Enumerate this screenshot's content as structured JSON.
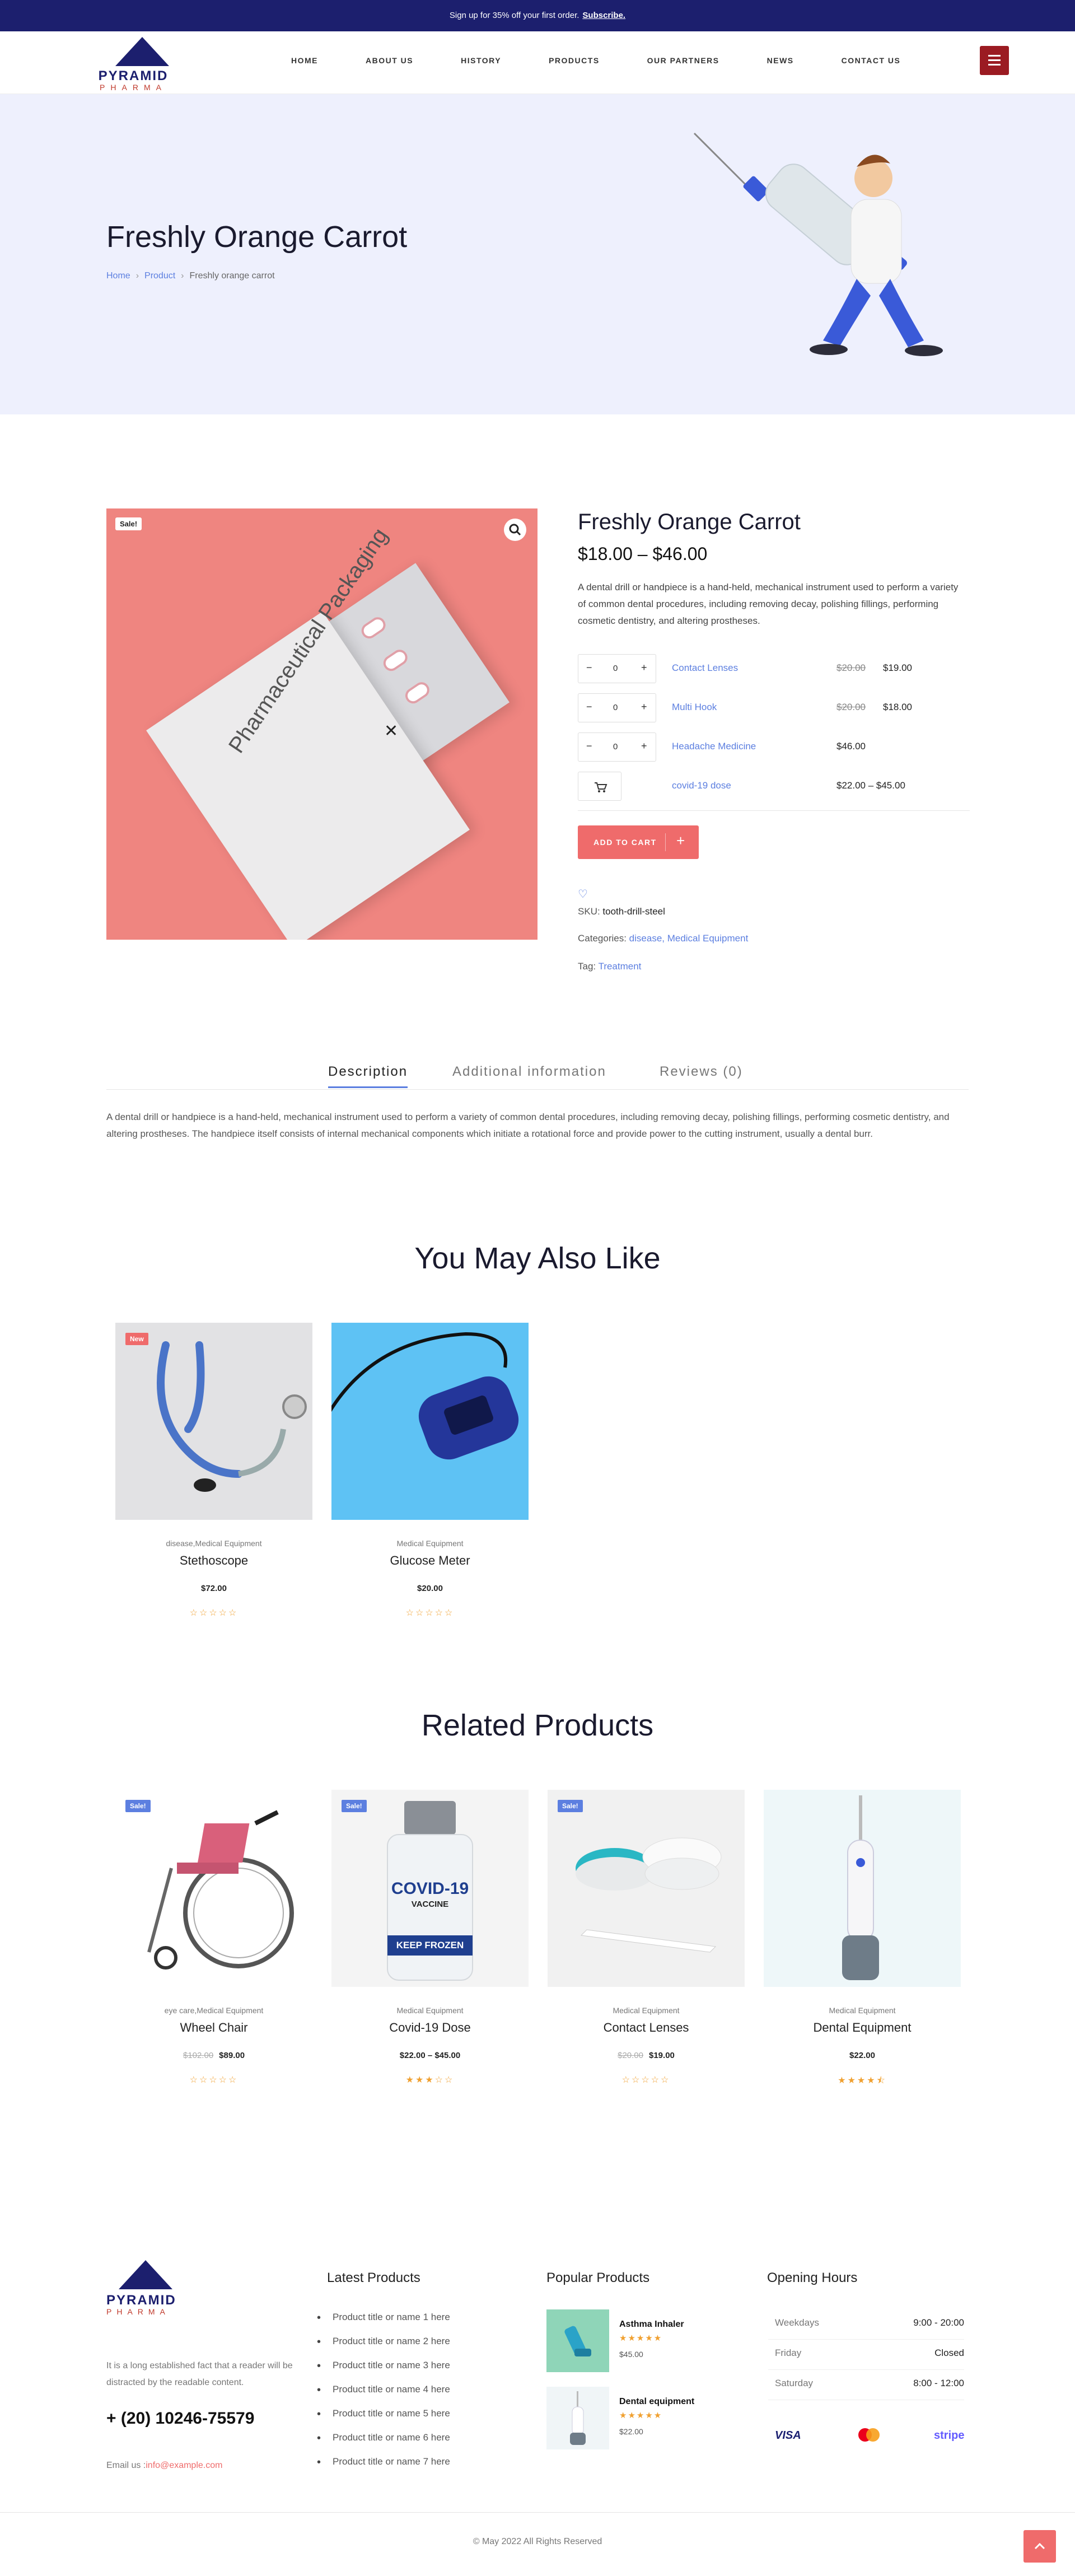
{
  "promo": {
    "text": "Sign up for 35% off your first order.",
    "link": "Subscribe."
  },
  "logo": {
    "word1": "PYRAMID",
    "word2": "PHARMA"
  },
  "nav": [
    "HOME",
    "ABOUT US",
    "HISTORY",
    "PRODUCTS",
    "OUR PARTNERS",
    "NEWS",
    "CONTACT US"
  ],
  "hero": {
    "title": "Freshly Orange Carrot",
    "crumbs": [
      "Home",
      "Product",
      "Freshly orange carrot"
    ]
  },
  "product": {
    "badge": "Sale!",
    "title": "Freshly Orange Carrot",
    "price": "$18.00 – $46.00",
    "description": "A dental drill or handpiece is a hand-held, mechanical instrument used to perform a variety of common dental procedures, including removing decay, polishing fillings, performing cosmetic dentistry, and altering prostheses.",
    "packaging_text": "Pharmaceutical Packaging",
    "grouped": [
      {
        "qty": "0",
        "name": "Contact Lenses",
        "old": "$20.00",
        "price": "$19.00"
      },
      {
        "qty": "0",
        "name": "Multi Hook",
        "old": "$20.00",
        "price": "$18.00"
      },
      {
        "qty": "0",
        "name": "Headache Medicine",
        "old": "",
        "price": "$46.00"
      },
      {
        "qty": "",
        "name": "covid-19 dose",
        "old": "",
        "price": "$22.00 – $45.00"
      }
    ],
    "add_to_cart": "ADD TO CART",
    "sku_label": "SKU:",
    "sku": "tooth-drill-steel",
    "categories_label": "Categories:",
    "categories": "disease, Medical Equipment",
    "tag_label": "Tag:",
    "tag": "Treatment"
  },
  "tabs": [
    "Description",
    "Additional information",
    "Reviews (0)"
  ],
  "tab_description": "A dental drill or handpiece is a hand-held, mechanical instrument used to perform a variety of common dental procedures, including removing decay, polishing fillings, performing cosmetic dentistry, and altering prostheses. The handpiece itself consists of internal mechanical components which initiate a rotational force and provide power to the cutting instrument, usually a dental burr.",
  "also_like": {
    "title": "You May Also Like",
    "items": [
      {
        "badge": "New",
        "cat": "disease,Medical Equipment",
        "name": "Stethoscope",
        "price": "$72.00",
        "rating": 0
      },
      {
        "badge": "",
        "cat": "Medical Equipment",
        "name": "Glucose Meter",
        "price": "$20.00",
        "rating": 0
      }
    ]
  },
  "related": {
    "title": "Related Products",
    "items": [
      {
        "badge": "Sale!",
        "cat": "eye care,Medical Equipment",
        "name": "Wheel Chair",
        "old": "$102.00",
        "price": "$89.00",
        "rating": 0
      },
      {
        "badge": "Sale!",
        "cat": "Medical Equipment",
        "name": "Covid-19 Dose",
        "old": "",
        "price": "$22.00 – $45.00",
        "rating": 3,
        "vial_1": "COVID-19",
        "vial_2": "VACCINE",
        "vial_3": "KEEP FROZEN"
      },
      {
        "badge": "Sale!",
        "cat": "Medical Equipment",
        "name": "Contact Lenses",
        "old": "$20.00",
        "price": "$19.00",
        "rating": 0
      },
      {
        "badge": "",
        "cat": "Medical Equipment",
        "name": "Dental Equipment",
        "old": "",
        "price": "$22.00",
        "rating": 4.5
      }
    ]
  },
  "footer": {
    "about": "It is a long established fact that a reader will be distracted by the readable content.",
    "phone": "+ (20) 10246-75579",
    "email_label": "Email us :",
    "email": "info@example.com",
    "latest_title": "Latest Products",
    "latest": [
      "Product title or name 1 here",
      "Product title or name 2 here",
      "Product title or name 3 here",
      "Product title or name 4 here",
      "Product title or name 5 here",
      "Product title or name 6 here",
      "Product title or name 7 here"
    ],
    "popular_title": "Popular Products",
    "popular": [
      {
        "name": "Asthma Inhaler",
        "price": "$45.00"
      },
      {
        "name": "Dental equipment",
        "price": "$22.00"
      }
    ],
    "hours_title": "Opening Hours",
    "hours": [
      {
        "day": "Weekdays",
        "time": "9:00 - 20:00"
      },
      {
        "day": "Friday",
        "time": "Closed"
      },
      {
        "day": "Saturday",
        "time": "8:00 - 12:00"
      }
    ],
    "payments": [
      "VISA",
      "stripe"
    ],
    "copyright": "© May 2022 All Rights Reserved"
  },
  "colors": {
    "navy": "#1c1f6e",
    "accent": "#ef6b6b",
    "link": "#5c7fe0",
    "hero_bg": "#eef0fd",
    "menu": "#9b1b22"
  }
}
